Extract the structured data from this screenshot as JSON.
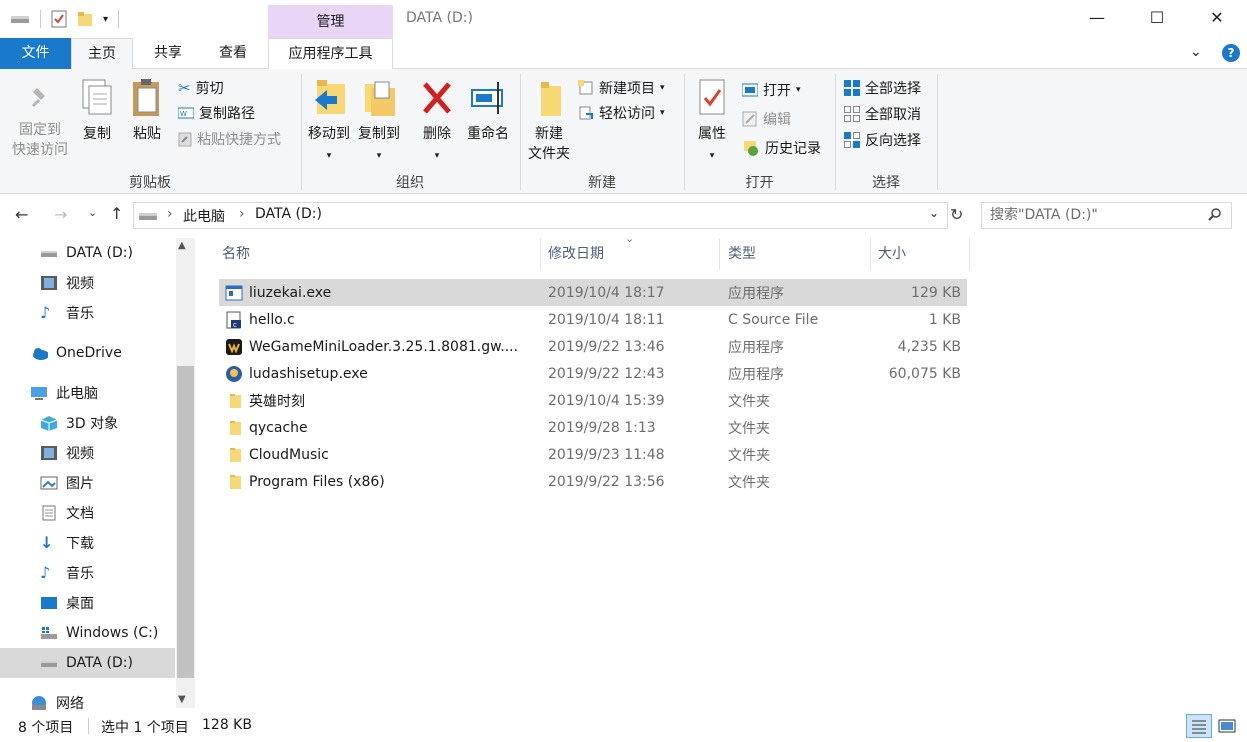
{
  "title_bar": {
    "context_tab": "管理",
    "window_title": "DATA (D:)",
    "minimize": "—",
    "maximize": "☐",
    "close": "✕"
  },
  "tabs": {
    "file": "文件",
    "home": "主页",
    "share": "共享",
    "view": "查看",
    "app_tools": "应用程序工具"
  },
  "ribbon": {
    "clipboard": {
      "label": "剪贴板",
      "pin": "固定到",
      "pin2": "快速访问",
      "copy": "复制",
      "paste": "粘贴",
      "cut": "剪切",
      "copy_path": "复制路径",
      "paste_shortcut": "粘贴快捷方式"
    },
    "organize": {
      "label": "组织",
      "move_to": "移动到",
      "copy_to": "复制到",
      "delete": "删除",
      "rename": "重命名"
    },
    "new": {
      "label": "新建",
      "new_folder": "新建",
      "new_folder2": "文件夹",
      "new_item": "新建项目",
      "easy_access": "轻松访问"
    },
    "open": {
      "label": "打开",
      "properties": "属性",
      "open": "打开",
      "edit": "编辑",
      "history": "历史记录"
    },
    "select": {
      "label": "选择",
      "select_all": "全部选择",
      "select_none": "全部取消",
      "invert": "反向选择"
    }
  },
  "address": {
    "crumbs": [
      "此电脑",
      "DATA (D:)"
    ],
    "separator": "›",
    "search_placeholder": "搜索\"DATA (D:)\""
  },
  "nav": {
    "items": [
      {
        "label": "DATA (D:)"
      },
      {
        "label": "视频"
      },
      {
        "label": "音乐"
      },
      {
        "label": "OneDrive"
      },
      {
        "label": "此电脑"
      },
      {
        "label": "3D 对象"
      },
      {
        "label": "视频"
      },
      {
        "label": "图片"
      },
      {
        "label": "文档"
      },
      {
        "label": "下载"
      },
      {
        "label": "音乐"
      },
      {
        "label": "桌面"
      },
      {
        "label": "Windows (C:)"
      },
      {
        "label": "DATA (D:)"
      },
      {
        "label": "网络"
      }
    ]
  },
  "columns": {
    "name": "名称",
    "date": "修改日期",
    "type": "类型",
    "size": "大小"
  },
  "files": [
    {
      "name": "liuzekai.exe",
      "date": "2019/10/4 18:17",
      "type": "应用程序",
      "size": "129 KB",
      "icon": "exe-icon",
      "selected": true
    },
    {
      "name": "hello.c",
      "date": "2019/10/4 18:11",
      "type": "C Source File",
      "size": "1 KB",
      "icon": "c-file-icon"
    },
    {
      "name": "WeGameMiniLoader.3.25.1.8081.gw....",
      "date": "2019/9/22 13:46",
      "type": "应用程序",
      "size": "4,235 KB",
      "icon": "wegame-icon"
    },
    {
      "name": "ludashisetup.exe",
      "date": "2019/9/22 12:43",
      "type": "应用程序",
      "size": "60,075 KB",
      "icon": "ludashi-icon"
    },
    {
      "name": "英雄时刻",
      "date": "2019/10/4 15:39",
      "type": "文件夹",
      "size": "",
      "icon": "folder-icon"
    },
    {
      "name": "qycache",
      "date": "2019/9/28 1:13",
      "type": "文件夹",
      "size": "",
      "icon": "folder-icon"
    },
    {
      "name": "CloudMusic",
      "date": "2019/9/23 11:48",
      "type": "文件夹",
      "size": "",
      "icon": "folder-icon"
    },
    {
      "name": "Program Files (x86)",
      "date": "2019/9/22 13:56",
      "type": "文件夹",
      "size": "",
      "icon": "folder-icon"
    }
  ],
  "status": {
    "count": "8 个项目",
    "selected": "选中 1 个项目",
    "size": "128 KB"
  },
  "colors": {
    "accent": "#1979ca",
    "context_tab": "#e9d5f5",
    "selected_row": "#d9d9d9"
  }
}
